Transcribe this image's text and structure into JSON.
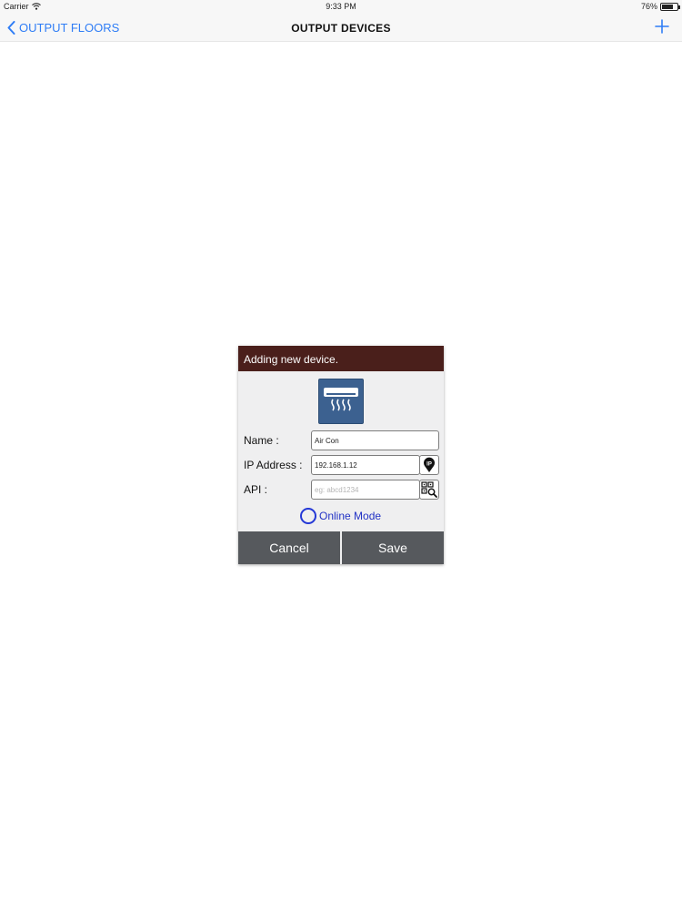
{
  "status_bar": {
    "carrier": "Carrier",
    "time": "9:33 PM",
    "battery_percent": "76%",
    "battery_level": 0.76
  },
  "nav": {
    "back_label": "OUTPUT FLOORS",
    "title": "OUTPUT DEVICES",
    "back_icon": "chevron-left-icon",
    "add_icon": "plus-icon",
    "accent_color": "#2f7df6"
  },
  "dialog": {
    "header": "Adding new device.",
    "header_color": "#4a1f1b",
    "device_icon": "air-conditioner-icon",
    "fields": {
      "name_label": "Name :",
      "name_value": "Air Con",
      "ip_label": "IP Address :",
      "ip_value": "192.168.1.12",
      "ip_button_icon": "ip-location-icon",
      "api_label": "API :",
      "api_placeholder": "eg: abcd1234",
      "api_button_icon": "qr-scan-icon"
    },
    "online_mode_label": "Online Mode",
    "online_mode_checked": false,
    "cancel_label": "Cancel",
    "save_label": "Save"
  }
}
